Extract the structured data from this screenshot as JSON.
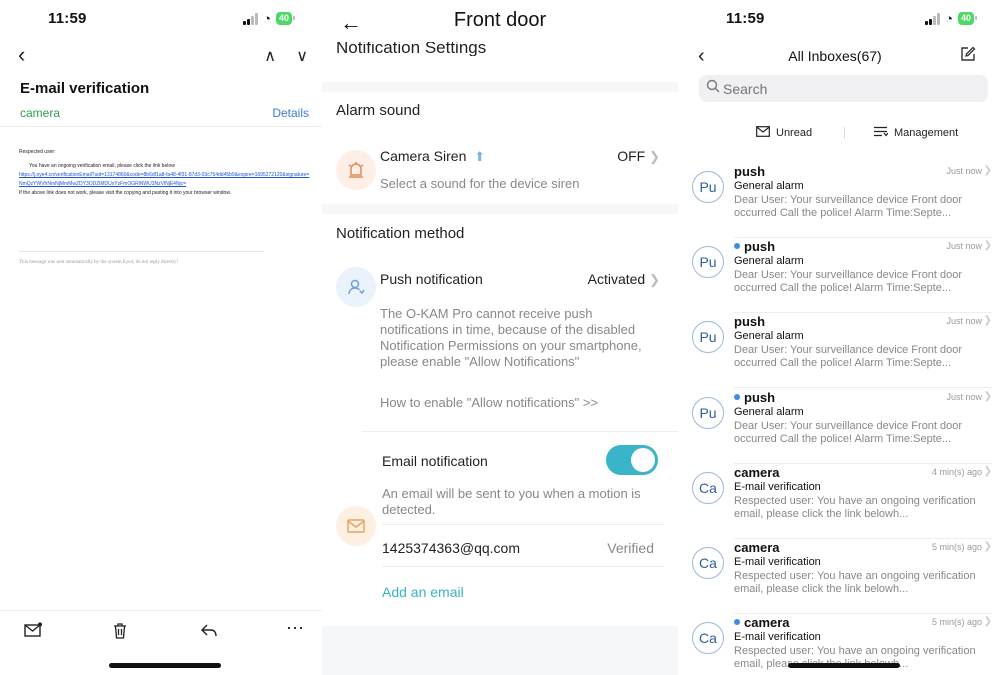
{
  "panel_email": {
    "status_time": "11:59",
    "battery": "40",
    "title": "E-mail verification",
    "from": "camera",
    "details_label": "Details",
    "body": {
      "greeting": "Respected user:",
      "intro": "You have an ongoing verification email, please click the link below",
      "link": "https://j.oye4.cn/verificationEmail?uid=13174860&code=8b6df1a8-fa48-4f31-87d3-03c754dd45b9&expire=1695272120&signature=NmQzYWVhNmNjMmMwZDY3ODZiMDUxYzFmOGRlNWU3NzVlNjE4Njc=",
      "fallback": "If the above link does not work, please visit the copying and pasting it into your browser window.",
      "footer": "This message was sent automatically by the system Eye4, do not reply directly!"
    }
  },
  "panel_settings": {
    "header_title": "Front door",
    "scrolled_heading": "Notification Settings",
    "alarm_section_title": "Alarm sound",
    "siren_label": "Camera Siren",
    "siren_value": "OFF",
    "siren_desc": "Select a sound for the device siren",
    "method_section_title": "Notification method",
    "push_label": "Push notification",
    "push_value": "Activated",
    "push_warning": "The O-KAM Pro cannot receive push notifications in time, because of the disabled Notification Permissions on your smartphone, please enable \"Allow Notifications\"",
    "how_to_enable": "How to enable \"Allow notifications\" >>",
    "email_label": "Email notification",
    "email_toggle_on": true,
    "email_desc": "An email will be sent to you when a motion is detected.",
    "email_address": "1425374363@qq.com",
    "email_status": "Verified",
    "add_email": "Add an email",
    "accent_color": "#39b3c5"
  },
  "panel_inbox": {
    "status_time": "11:59",
    "battery": "40",
    "title": "All Inboxes(67)",
    "search_placeholder": "Search",
    "filter_unread": "Unread",
    "filter_management": "Management",
    "mails": [
      {
        "avatar": "Pu",
        "sender": "push",
        "unread": false,
        "time": "Just now",
        "subject": "General alarm",
        "preview": "Dear User: Your surveillance device Front door occurred Call the police!    Alarm Time:Septe..."
      },
      {
        "avatar": "Pu",
        "sender": "push",
        "unread": true,
        "time": "Just now",
        "subject": "General alarm",
        "preview": "Dear User: Your surveillance device Front door occurred Call the police!    Alarm Time:Septe..."
      },
      {
        "avatar": "Pu",
        "sender": "push",
        "unread": false,
        "time": "Just now",
        "subject": "General alarm",
        "preview": "Dear User: Your surveillance device Front door occurred Call the police!    Alarm Time:Septe..."
      },
      {
        "avatar": "Pu",
        "sender": "push",
        "unread": true,
        "time": "Just now",
        "subject": "General alarm",
        "preview": "Dear User: Your surveillance device Front door occurred Call the police!    Alarm Time:Septe..."
      },
      {
        "avatar": "Ca",
        "sender": "camera",
        "unread": false,
        "time": "4 min(s) ago",
        "subject": "E-mail verification",
        "preview": "Respected user: You have an ongoing verification email, please click the link belowh..."
      },
      {
        "avatar": "Ca",
        "sender": "camera",
        "unread": false,
        "time": "5 min(s) ago",
        "subject": "E-mail verification",
        "preview": "Respected user: You have an ongoing verification email, please click the link belowh..."
      },
      {
        "avatar": "Ca",
        "sender": "camera",
        "unread": true,
        "time": "5 min(s) ago",
        "subject": "E-mail verification",
        "preview": "Respected user: You have an ongoing verification email, please click the link belowh..."
      }
    ]
  }
}
